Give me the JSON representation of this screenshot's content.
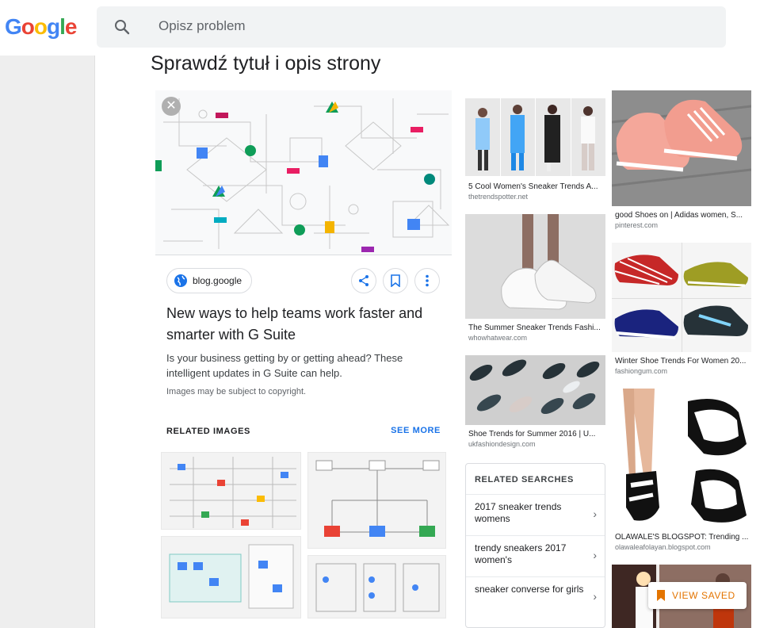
{
  "header": {
    "logo_letters": [
      {
        "ch": "G",
        "color": "#4285F4"
      },
      {
        "ch": "o",
        "color": "#EA4335"
      },
      {
        "ch": "o",
        "color": "#FBBC05"
      },
      {
        "ch": "g",
        "color": "#4285F4"
      },
      {
        "ch": "l",
        "color": "#34A853"
      },
      {
        "ch": "e",
        "color": "#EA4335"
      }
    ],
    "search_placeholder": "Opisz problem",
    "search_icon": "search-icon"
  },
  "page_title": "Sprawdź tytuł i opis strony",
  "detail": {
    "source": "blog.google",
    "title": "New ways to help teams work faster and smarter with G Suite",
    "description": "Is your business getting by or getting ahead? These intelligent updates in G Suite can help.",
    "copyright_note": "Images may be subject to copyright.",
    "related_images_label": "RELATED IMAGES",
    "see_more_label": "SEE MORE",
    "actions": [
      "share-icon",
      "bookmark-icon",
      "more-vert-icon"
    ]
  },
  "column_one": [
    {
      "caption": "5 Cool Women's Sneaker Trends A...",
      "source": "thetrendspotter.net"
    },
    {
      "caption": "The Summer Sneaker Trends Fashi...",
      "source": "whowhatwear.com"
    },
    {
      "caption": "Shoe Trends for Summer 2016 | U...",
      "source": "ukfashiondesign.com"
    }
  ],
  "related_searches": {
    "title": "RELATED SEARCHES",
    "items": [
      "2017 sneaker trends womens",
      "trendy sneakers 2017 women's",
      "sneaker converse for girls"
    ]
  },
  "column_two": [
    {
      "caption": "good Shoes on | Adidas women, S...",
      "source": "pinterest.com"
    },
    {
      "caption": "Winter Shoe Trends For Women 20...",
      "source": "fashiongum.com"
    },
    {
      "caption": "OLAWALE'S BLOGSPOT: Trending ...",
      "source": "olawaleafolayan.blogspot.com"
    }
  ],
  "view_saved_label": "VIEW SAVED",
  "colors": {
    "accent_blue": "#1a73e8",
    "saved_orange": "#e37400"
  }
}
